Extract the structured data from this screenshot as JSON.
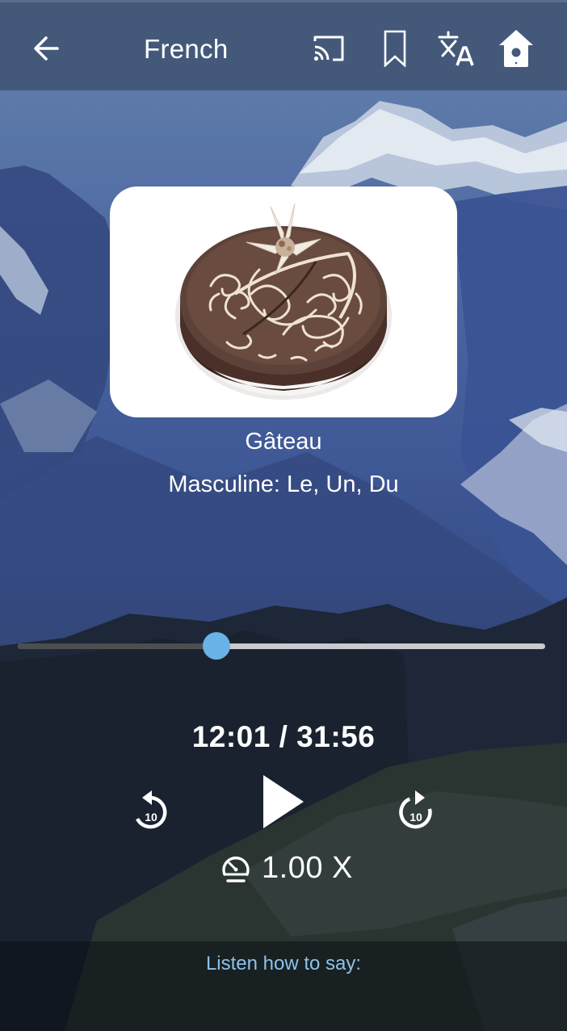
{
  "header": {
    "title": "French",
    "icons": {
      "back": "arrow-left-icon",
      "cast": "cast-icon",
      "bookmark": "bookmark-icon",
      "translate": "translate-icon",
      "home": "birdhouse-home-icon"
    }
  },
  "card": {
    "image": "chocolate-cake",
    "word": "Gâteau",
    "gender": "Masculine: Le, Un, Du"
  },
  "player": {
    "current_time": "12:01",
    "total_time": "31:56",
    "time_display": "12:01 / 31:56",
    "progress_fraction": 0.376,
    "rewind_seconds": "10",
    "forward_seconds": "10",
    "speed": "1.00 X",
    "play_state": "paused"
  },
  "footer": {
    "listen_label": "Listen how to say:"
  },
  "colors": {
    "header_bg": "#44597a",
    "accent": "#6ab3e6",
    "listen_text": "#8ec2ea",
    "track_played": "#4c4e50",
    "track_remaining": "#c9cacd"
  }
}
